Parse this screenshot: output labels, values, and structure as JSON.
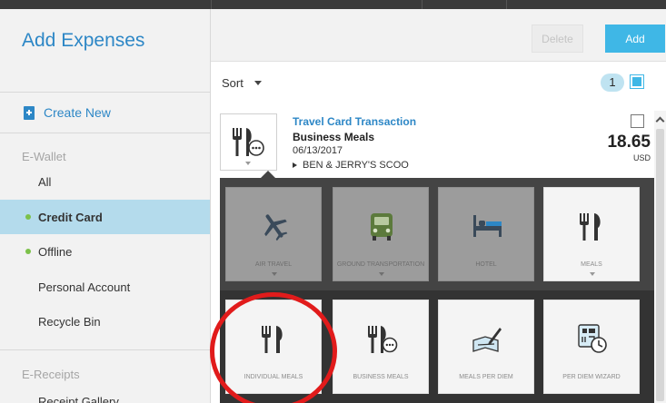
{
  "sidebar": {
    "title": "Add Expenses",
    "create_new": "Create New",
    "ewallet_section": "E-Wallet",
    "ewallet_items": [
      {
        "label": "All"
      },
      {
        "label": "Credit Card"
      },
      {
        "label": "Offline"
      },
      {
        "label": "Personal Account"
      },
      {
        "label": "Recycle Bin"
      }
    ],
    "ereceipts_section": "E-Receipts",
    "ereceipts_items": [
      {
        "label": "Receipt Gallery"
      }
    ]
  },
  "toolbar": {
    "delete_label": "Delete",
    "add_label": "Add"
  },
  "list": {
    "sort_label": "Sort",
    "selected_count": "1"
  },
  "transaction": {
    "title": "Travel Card Transaction",
    "expense_type": "Business Meals",
    "date": "06/13/2017",
    "merchant": "BEN & JERRY'S SCOO",
    "amount": "18.65",
    "currency": "USD"
  },
  "categories": [
    {
      "label": "AIR TRAVEL",
      "icon": "airplane-icon"
    },
    {
      "label": "GROUND TRANSPORTATION",
      "icon": "car-icon"
    },
    {
      "label": "HOTEL",
      "icon": "bed-icon"
    },
    {
      "label": "MEALS",
      "icon": "fork-knife-icon"
    }
  ],
  "meal_types": [
    {
      "label": "INDIVIDUAL MEALS",
      "icon": "fork-knife-icon"
    },
    {
      "label": "BUSINESS MEALS",
      "icon": "business-meals-icon"
    },
    {
      "label": "MEALS PER DIEM",
      "icon": "pen-document-icon"
    },
    {
      "label": "PER DIEM WIZARD",
      "icon": "per-diem-wizard-icon"
    }
  ],
  "colors": {
    "accent": "#3fb7e6",
    "link": "#2d87c6",
    "active_bg": "#b4dbec",
    "status_dot": "#7cc14a",
    "highlight": "#e11b1b"
  }
}
